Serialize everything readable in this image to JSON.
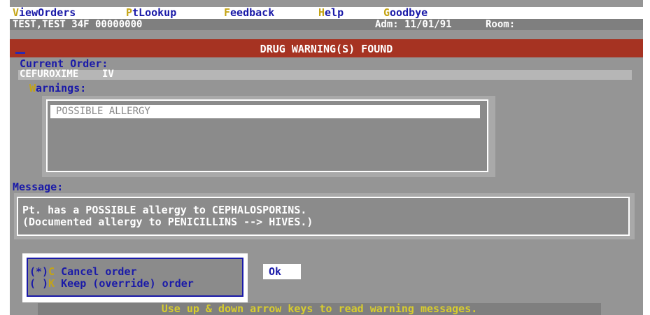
{
  "menu": {
    "items": [
      {
        "hotkey": "V",
        "rest": "iewOrders"
      },
      {
        "hotkey": "P",
        "rest": "tLookup"
      },
      {
        "hotkey": "F",
        "rest": "eedback"
      },
      {
        "hotkey": "H",
        "rest": "elp"
      },
      {
        "hotkey": "G",
        "rest": "oodbye"
      }
    ]
  },
  "patient": {
    "info": "TEST,TEST   34F  00000000",
    "admission": "Adm: 11/01/91",
    "room": "Room:"
  },
  "dialog": {
    "title": "DRUG WARNING(S) FOUND",
    "current_order_label": "Current Order:",
    "current_order_value": "CEFUROXIME    IV",
    "warnings_hotkey": "W",
    "warnings_rest": "arnings:",
    "warnings": [
      "POSSIBLE ALLERGY"
    ],
    "message_label": "Message:",
    "message_lines": [
      "Pt. has a POSSIBLE allergy to CEPHALOSPORINS.",
      "(Documented allergy to PENICILLINS --> HIVES.)"
    ],
    "options": [
      {
        "marker": "(*)",
        "key": "C",
        "text": " Cancel order",
        "selected": true
      },
      {
        "marker": "( )",
        "key": "K",
        "text": " Keep (override) order",
        "selected": false
      }
    ],
    "ok_label": "Ok"
  },
  "status_bar": "Use up & down arrow keys to read warning messages.",
  "colors": {
    "background": "#959595",
    "menu_text": "#1a1aa8",
    "hotkey": "#c4a416",
    "title_bar": "#a63322",
    "status_text": "#d7cc2e"
  }
}
